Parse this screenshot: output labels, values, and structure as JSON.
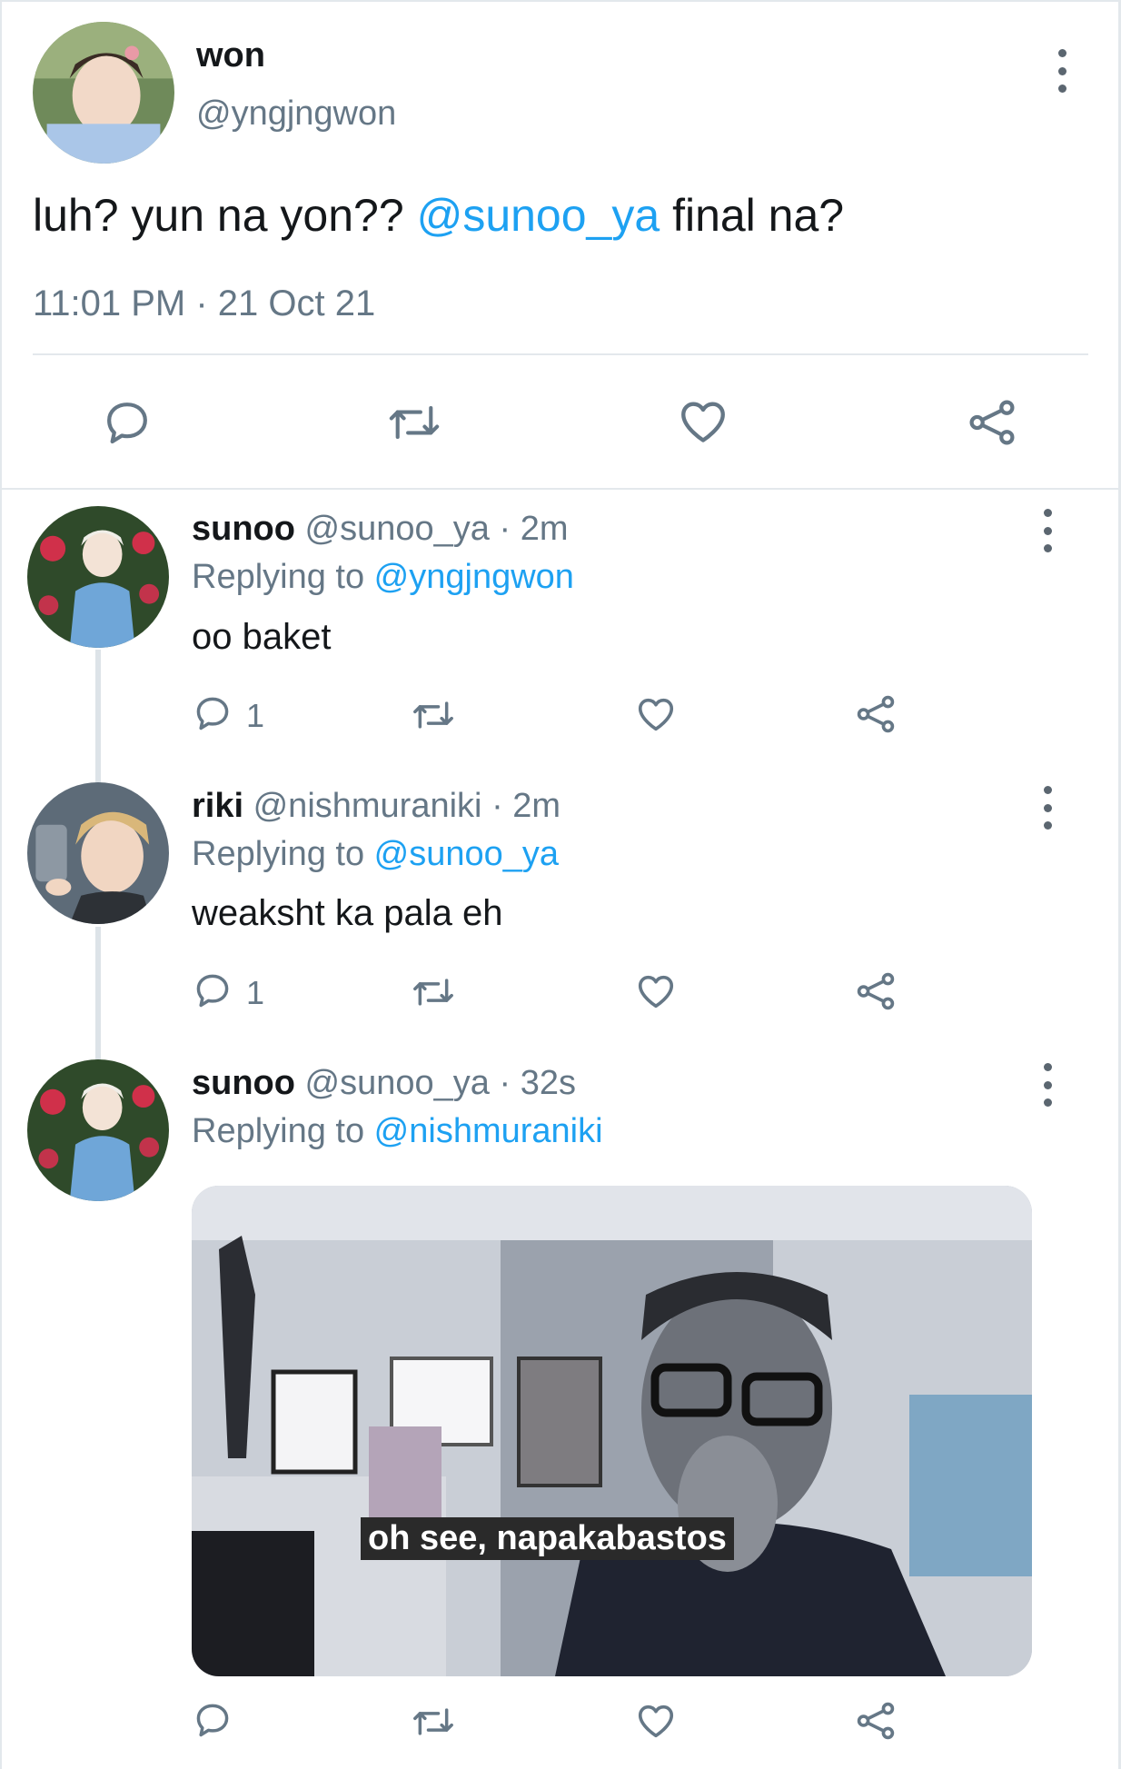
{
  "main_tweet": {
    "display_name": "won",
    "handle": "@yngjngwon",
    "text_before": "luh? yun na yon?? ",
    "mention": "@sunoo_ya",
    "text_after": " final na?",
    "timestamp": "11:01 PM · 21 Oct 21"
  },
  "replies": [
    {
      "display_name": "sunoo",
      "handle": "@sunoo_ya",
      "time": "· 2m",
      "replying_prefix": "Replying to ",
      "replying_to": "@yngjngwon",
      "text": "oo baket",
      "reply_count": "1"
    },
    {
      "display_name": "riki",
      "handle": "@nishmuraniki",
      "time": "· 2m",
      "replying_prefix": "Replying to ",
      "replying_to": "@sunoo_ya",
      "text": "weaksht ka pala eh",
      "reply_count": "1"
    },
    {
      "display_name": "sunoo",
      "handle": "@sunoo_ya",
      "time": "· 32s",
      "replying_prefix": "Replying to ",
      "replying_to": "@nishmuraniki",
      "media_caption": "oh see, napakabastos"
    }
  ],
  "colors": {
    "accent": "#1da1f2",
    "muted": "#657786",
    "divider": "#e3e8ec"
  },
  "icons": [
    "reply-icon",
    "retweet-icon",
    "like-icon",
    "share-icon",
    "more-icon"
  ]
}
